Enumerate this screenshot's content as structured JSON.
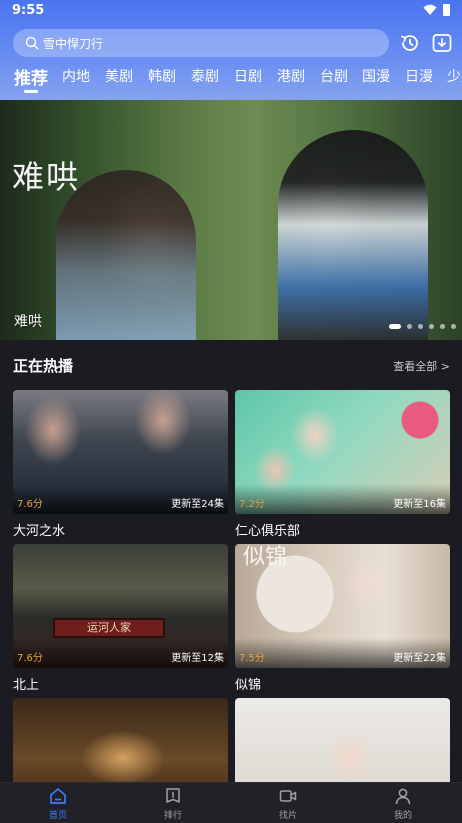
{
  "status_bar": {
    "time": "9:55"
  },
  "search": {
    "text": "雪中悍刀行"
  },
  "tabs": [
    {
      "label": "推荐",
      "active": true
    },
    {
      "label": "内地"
    },
    {
      "label": "美剧"
    },
    {
      "label": "韩剧"
    },
    {
      "label": "泰剧"
    },
    {
      "label": "日剧"
    },
    {
      "label": "港剧"
    },
    {
      "label": "台剧"
    },
    {
      "label": "国漫"
    },
    {
      "label": "日漫"
    },
    {
      "label": "少儿"
    }
  ],
  "banner": {
    "calligraphy": "难哄",
    "title": "难哄",
    "slide_count": 6,
    "active_slide": 1
  },
  "section": {
    "title": "正在热播",
    "view_all": "查看全部 >"
  },
  "cards": [
    {
      "name": "大河之水",
      "rating": "7.6分",
      "update": "更新至24集"
    },
    {
      "name": "仁心俱乐部",
      "rating": "7.2分",
      "update": "更新至16集"
    },
    {
      "name": "北上",
      "rating": "7.6分",
      "update": "更新至12集",
      "sign_text": "运河人家"
    },
    {
      "name": "似锦",
      "rating": "7.5分",
      "update": "更新至22集",
      "calligraphy": "似锦"
    },
    {
      "name": "",
      "rating": "",
      "update": ""
    },
    {
      "name": "",
      "rating": "",
      "update": ""
    }
  ],
  "bottom_nav": [
    {
      "label": "首页",
      "icon": "home-icon",
      "active": true
    },
    {
      "label": "排行",
      "icon": "ranking-icon"
    },
    {
      "label": "找片",
      "icon": "video-camera-icon"
    },
    {
      "label": "我的",
      "icon": "profile-icon"
    }
  ],
  "colors": {
    "accent": "#3f7bff",
    "header_top": "#4a74f0",
    "rating": "#e6a33c",
    "background": "#1a1c22"
  }
}
